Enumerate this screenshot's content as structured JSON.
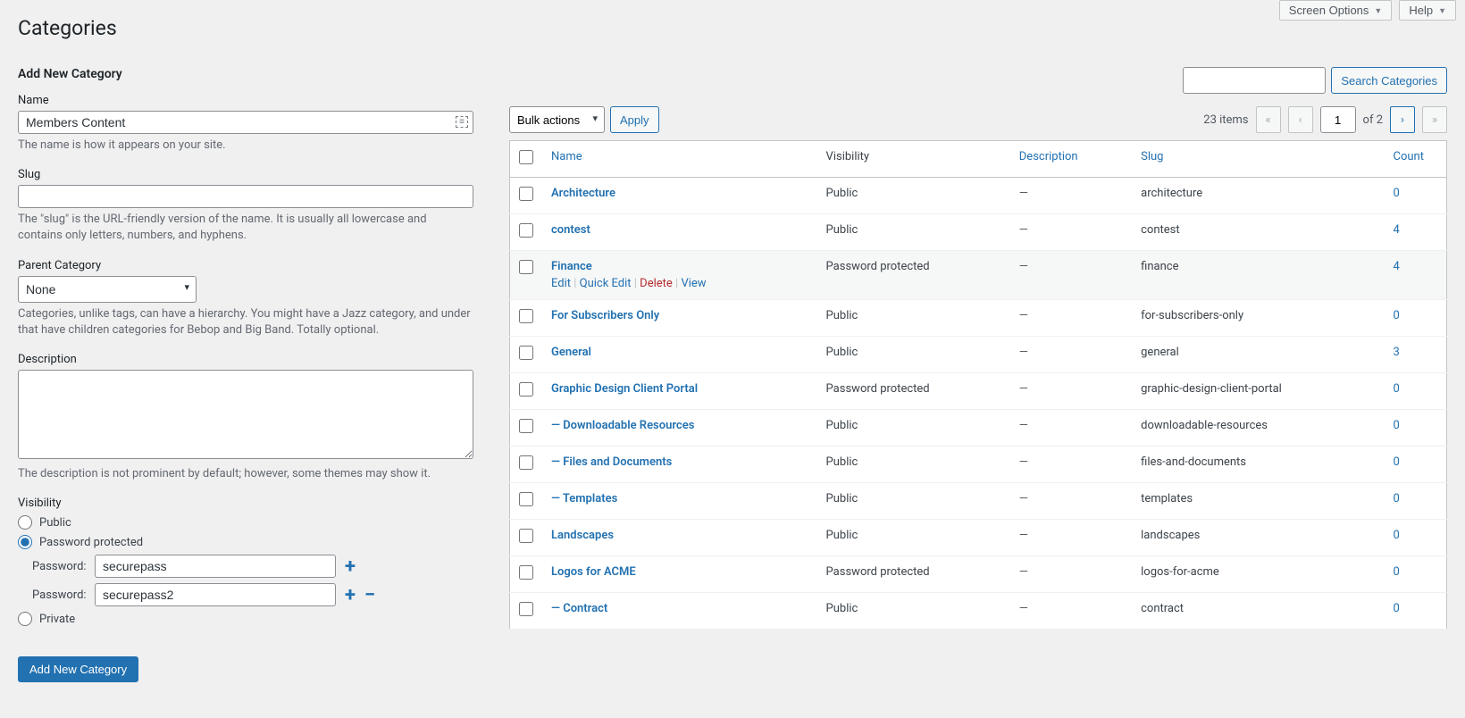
{
  "topButtons": {
    "screenOptions": "Screen Options",
    "help": "Help"
  },
  "page": {
    "title": "Categories"
  },
  "form": {
    "heading": "Add New Category",
    "name": {
      "label": "Name",
      "value": "Members Content",
      "desc": "The name is how it appears on your site."
    },
    "slug": {
      "label": "Slug",
      "value": "",
      "desc": "The \"slug\" is the URL-friendly version of the name. It is usually all lowercase and contains only letters, numbers, and hyphens."
    },
    "parent": {
      "label": "Parent Category",
      "value": "None",
      "desc": "Categories, unlike tags, can have a hierarchy. You might have a Jazz category, and under that have children categories for Bebop and Big Band. Totally optional."
    },
    "description": {
      "label": "Description",
      "value": "",
      "desc": "The description is not prominent by default; however, some themes may show it."
    },
    "visibility": {
      "label": "Visibility",
      "options": {
        "public": "Public",
        "password": "Password protected",
        "private": "Private"
      },
      "selected": "password",
      "passwordLabel": "Password:",
      "passwords": [
        "securepass",
        "securepass2"
      ]
    },
    "submit": "Add New Category"
  },
  "search": {
    "button": "Search Categories"
  },
  "bulk": {
    "label": "Bulk actions",
    "apply": "Apply"
  },
  "pagination": {
    "items": "23 items",
    "current": "1",
    "of": "of 2"
  },
  "table": {
    "headers": {
      "name": "Name",
      "visibility": "Visibility",
      "description": "Description",
      "slug": "Slug",
      "count": "Count"
    },
    "rowActions": {
      "edit": "Edit",
      "quickEdit": "Quick Edit",
      "delete": "Delete",
      "view": "View"
    },
    "rows": [
      {
        "name": "Architecture",
        "indent": 0,
        "visibility": "Public",
        "description": "—",
        "slug": "architecture",
        "count": "0",
        "hover": false
      },
      {
        "name": "contest",
        "indent": 0,
        "visibility": "Public",
        "description": "—",
        "slug": "contest",
        "count": "4",
        "hover": false
      },
      {
        "name": "Finance",
        "indent": 0,
        "visibility": "Password protected",
        "description": "—",
        "slug": "finance",
        "count": "4",
        "hover": true
      },
      {
        "name": "For Subscribers Only",
        "indent": 0,
        "visibility": "Public",
        "description": "—",
        "slug": "for-subscribers-only",
        "count": "0",
        "hover": false
      },
      {
        "name": "General",
        "indent": 0,
        "visibility": "Public",
        "description": "—",
        "slug": "general",
        "count": "3",
        "hover": false
      },
      {
        "name": "Graphic Design Client Portal",
        "indent": 0,
        "visibility": "Password protected",
        "description": "—",
        "slug": "graphic-design-client-portal",
        "count": "0",
        "hover": false
      },
      {
        "name": "Downloadable Resources",
        "indent": 1,
        "visibility": "Public",
        "description": "—",
        "slug": "downloadable-resources",
        "count": "0",
        "hover": false
      },
      {
        "name": "Files and Documents",
        "indent": 1,
        "visibility": "Public",
        "description": "—",
        "slug": "files-and-documents",
        "count": "0",
        "hover": false
      },
      {
        "name": "Templates",
        "indent": 1,
        "visibility": "Public",
        "description": "—",
        "slug": "templates",
        "count": "0",
        "hover": false
      },
      {
        "name": "Landscapes",
        "indent": 0,
        "visibility": "Public",
        "description": "—",
        "slug": "landscapes",
        "count": "0",
        "hover": false
      },
      {
        "name": "Logos for ACME",
        "indent": 0,
        "visibility": "Password protected",
        "description": "—",
        "slug": "logos-for-acme",
        "count": "0",
        "hover": false
      },
      {
        "name": "Contract",
        "indent": 1,
        "visibility": "Public",
        "description": "—",
        "slug": "contract",
        "count": "0",
        "hover": false
      }
    ]
  }
}
